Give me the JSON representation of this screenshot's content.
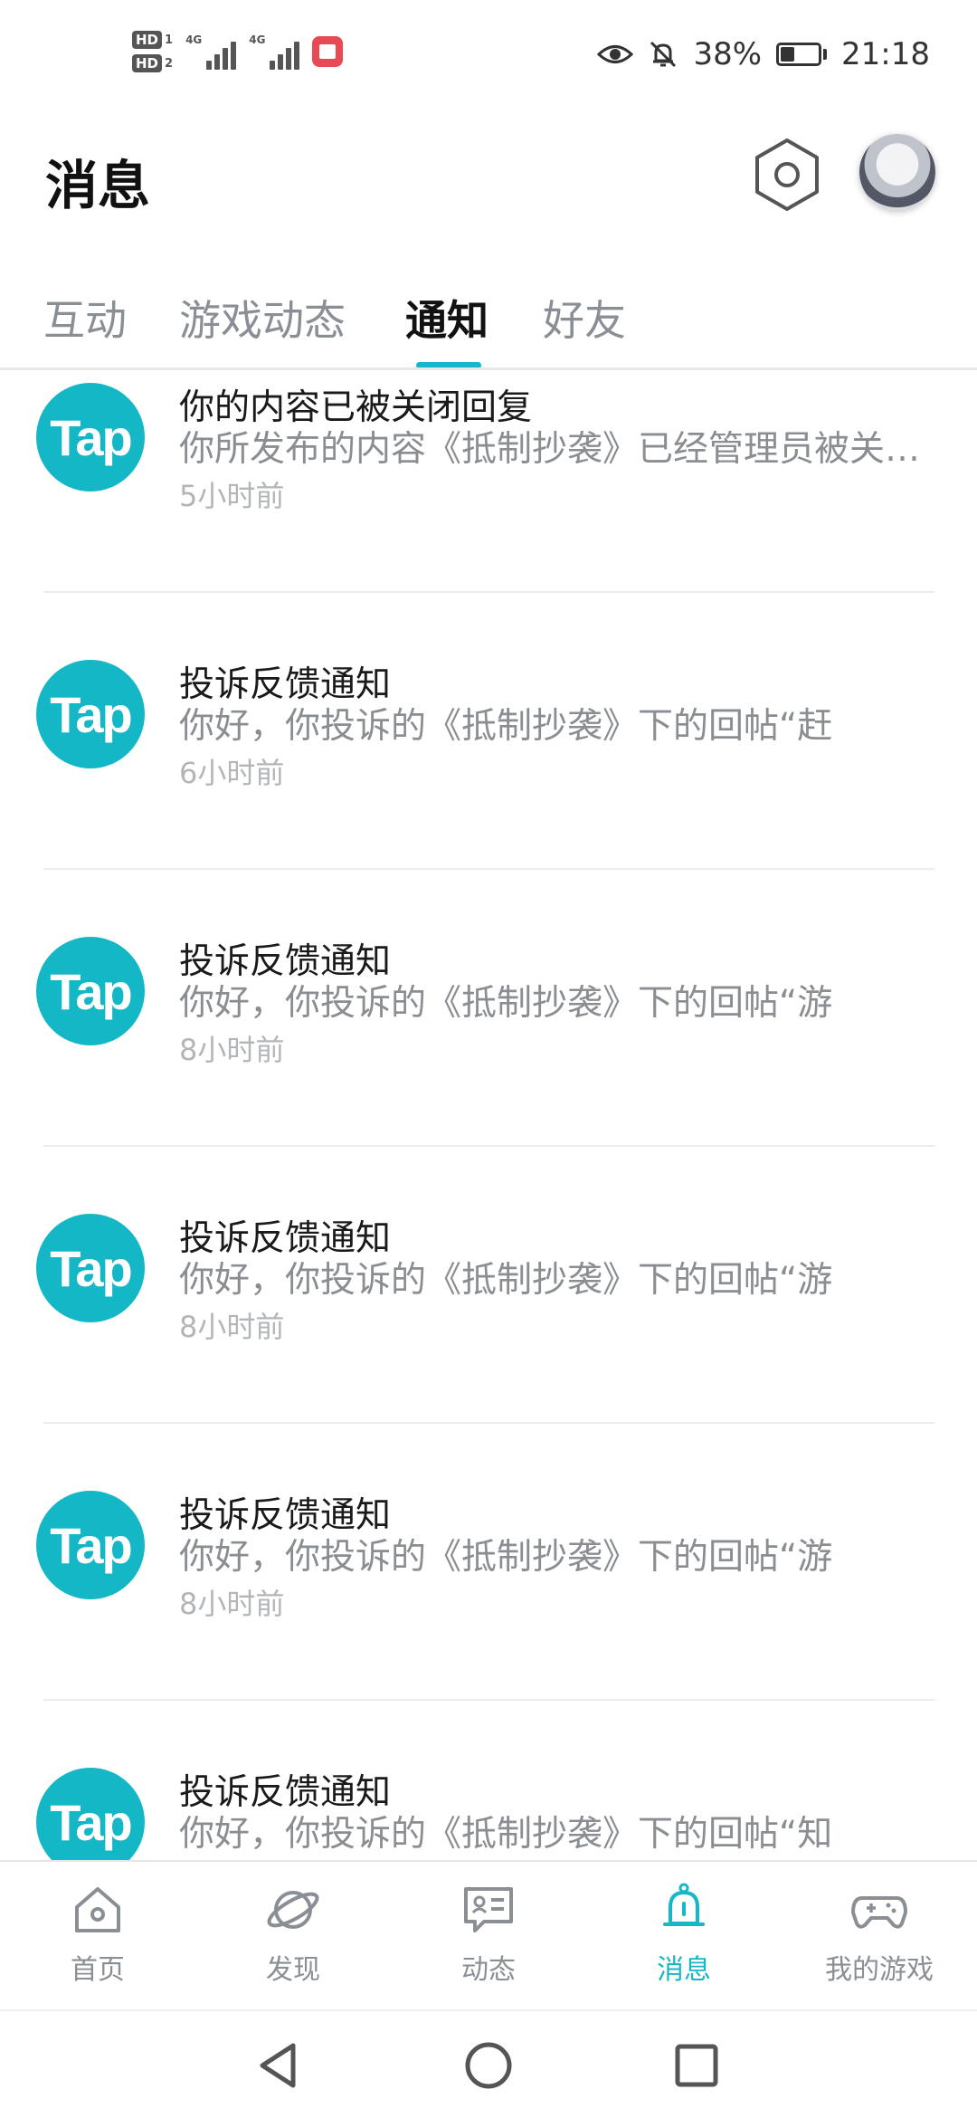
{
  "status_bar": {
    "hd_labels": [
      "HD",
      "HD"
    ],
    "hd_nums": [
      "1",
      "2"
    ],
    "network_labels": [
      "4G",
      "4G"
    ],
    "battery_percent": "38%",
    "battery_level": 0.38,
    "time": "21:18"
  },
  "header": {
    "title": "消息"
  },
  "tabs": [
    {
      "label": "互动"
    },
    {
      "label": "游戏动态"
    },
    {
      "label": "通知"
    },
    {
      "label": "好友"
    }
  ],
  "active_tab": "通知",
  "notifications": [
    {
      "logo": "Tap",
      "title": "你的内容已被关闭回复",
      "body": "你所发布的内容《抵制抄袭》已经管理员被关闭回复",
      "time": "5小时前"
    },
    {
      "logo": "Tap",
      "title": "投诉反馈通知",
      "body": "你好，你投诉的《抵制抄袭》下的回帖“赶",
      "time": "6小时前"
    },
    {
      "logo": "Tap",
      "title": "投诉反馈通知",
      "body": "你好，你投诉的《抵制抄袭》下的回帖“游",
      "time": "8小时前"
    },
    {
      "logo": "Tap",
      "title": "投诉反馈通知",
      "body": "你好，你投诉的《抵制抄袭》下的回帖“游",
      "time": "8小时前"
    },
    {
      "logo": "Tap",
      "title": "投诉反馈通知",
      "body": "你好，你投诉的《抵制抄袭》下的回帖“游",
      "time": "8小时前"
    },
    {
      "logo": "Tap",
      "title": "投诉反馈通知",
      "body": "你好，你投诉的《抵制抄袭》下的回帖“知",
      "time": ""
    }
  ],
  "bottom_nav": [
    {
      "label": "首页",
      "icon": "home-icon"
    },
    {
      "label": "发现",
      "icon": "planet-icon"
    },
    {
      "label": "动态",
      "icon": "chat-card-icon"
    },
    {
      "label": "消息",
      "icon": "bell-icon"
    },
    {
      "label": "我的游戏",
      "icon": "gamepad-icon"
    }
  ],
  "active_nav": "消息",
  "colors": {
    "accent": "#16b8c7",
    "tap_brand": "#14b7c6",
    "text_primary": "#1a1a1a",
    "text_secondary": "#8a8e92",
    "text_time": "#b3b6b9"
  }
}
